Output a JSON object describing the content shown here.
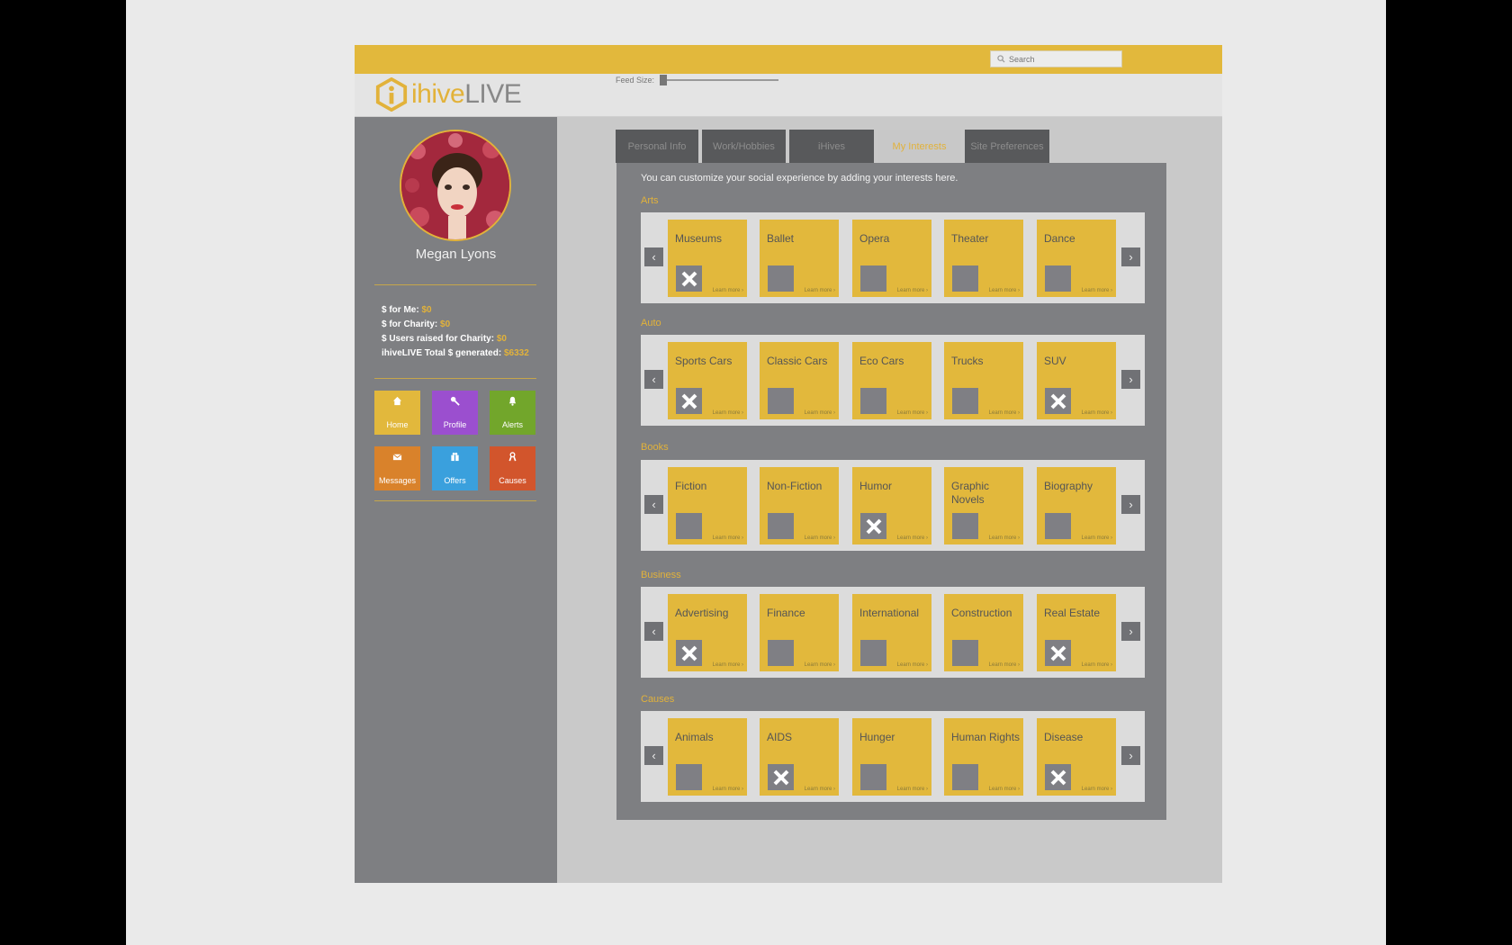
{
  "header": {
    "search_placeholder": "Search",
    "logo_part1": "ihive",
    "logo_part2": "LIVE",
    "feed_size_label": "Feed Size:"
  },
  "profile": {
    "name": "Megan Lyons",
    "stats": [
      {
        "label": "$ for Me: ",
        "value": "$0"
      },
      {
        "label": "$ for Charity: ",
        "value": "$0"
      },
      {
        "label": "$ Users  raised for Charity: ",
        "value": "$0"
      },
      {
        "label": "ihiveLIVE Total $ generated: ",
        "value": "$6332"
      }
    ]
  },
  "nav": [
    {
      "label": "Home",
      "icon": "home-icon",
      "color": "#e2b83c"
    },
    {
      "label": "Profile",
      "icon": "wrench-icon",
      "color": "#9b4fcf"
    },
    {
      "label": "Alerts",
      "icon": "bell-icon",
      "color": "#72a62b"
    },
    {
      "label": "Messages",
      "icon": "envelope-icon",
      "color": "#d9822b"
    },
    {
      "label": "Offers",
      "icon": "gift-icon",
      "color": "#3aa0dd"
    },
    {
      "label": "Causes",
      "icon": "ribbon-icon",
      "color": "#d2552c"
    }
  ],
  "tabs": [
    "Personal Info",
    "Work/Hobbies",
    "iHives",
    "My Interests",
    "Site Preferences"
  ],
  "active_tab": "My Interests",
  "intro": "You can customize your social experience by adding your interests here.",
  "learn_more": "Learn more ›",
  "categories": [
    {
      "name": "Arts",
      "items": [
        {
          "name": "Museums",
          "selected": true
        },
        {
          "name": "Ballet",
          "selected": false
        },
        {
          "name": "Opera",
          "selected": false
        },
        {
          "name": "Theater",
          "selected": false
        },
        {
          "name": "Dance",
          "selected": false
        }
      ]
    },
    {
      "name": "Auto",
      "items": [
        {
          "name": "Sports Cars",
          "selected": true
        },
        {
          "name": "Classic Cars",
          "selected": false
        },
        {
          "name": "Eco Cars",
          "selected": false
        },
        {
          "name": "Trucks",
          "selected": false
        },
        {
          "name": "SUV",
          "selected": true
        }
      ]
    },
    {
      "name": "Books",
      "items": [
        {
          "name": "Fiction",
          "selected": false
        },
        {
          "name": "Non-Fiction",
          "selected": false
        },
        {
          "name": "Humor",
          "selected": true
        },
        {
          "name": "Graphic Novels",
          "selected": false
        },
        {
          "name": "Biography",
          "selected": false
        }
      ]
    },
    {
      "name": "Business",
      "items": [
        {
          "name": "Advertising",
          "selected": true
        },
        {
          "name": "Finance",
          "selected": false
        },
        {
          "name": "International",
          "selected": false
        },
        {
          "name": "Construction",
          "selected": false
        },
        {
          "name": "Real Estate",
          "selected": true
        }
      ]
    },
    {
      "name": "Causes",
      "items": [
        {
          "name": "Animals",
          "selected": false
        },
        {
          "name": "AIDS",
          "selected": true
        },
        {
          "name": "Hunger",
          "selected": false
        },
        {
          "name": "Human Rights",
          "selected": false
        },
        {
          "name": "Disease",
          "selected": true
        }
      ]
    }
  ],
  "colors": {
    "accent": "#e2b83c",
    "panel": "#7e7f82",
    "tab": "#58595b"
  }
}
